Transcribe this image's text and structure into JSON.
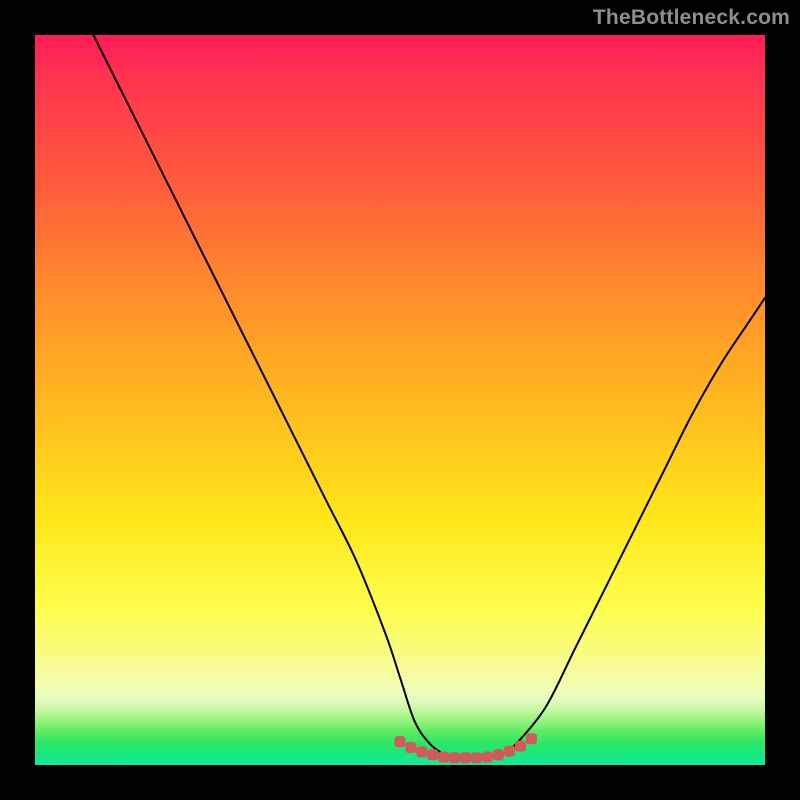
{
  "watermark": "TheBottleneck.com",
  "colors": {
    "curve": "#000000",
    "marker": "#d35a5a",
    "gradient_top": "#ff1c57",
    "gradient_mid": "#ffe61a",
    "gradient_bottom": "#11e99e",
    "frame": "#000000"
  },
  "chart_data": {
    "type": "line",
    "title": "",
    "xlabel": "",
    "ylabel": "",
    "xlim": [
      0,
      100
    ],
    "ylim": [
      0,
      100
    ],
    "series": [
      {
        "name": "bottleneck-curve",
        "x": [
          8,
          12,
          16,
          20,
          24,
          28,
          32,
          36,
          40,
          44,
          48,
          50,
          52,
          54,
          56,
          58,
          60,
          62,
          64,
          66,
          70,
          74,
          78,
          82,
          86,
          90,
          94,
          98,
          100
        ],
        "y": [
          100,
          92,
          84,
          76,
          68,
          60,
          52,
          44,
          36,
          28,
          18,
          12,
          6,
          3,
          1.5,
          1,
          1,
          1,
          1.5,
          3,
          8,
          16,
          24,
          32,
          40,
          48,
          55,
          61,
          64
        ]
      },
      {
        "name": "sweet-spot-markers",
        "x": [
          50,
          51.5,
          53,
          54.5,
          56,
          57.5,
          59,
          60.5,
          62,
          63.5,
          65,
          66.5,
          68
        ],
        "y": [
          3.2,
          2.4,
          1.8,
          1.4,
          1.1,
          1.0,
          1.0,
          1.0,
          1.1,
          1.4,
          1.9,
          2.6,
          3.6
        ]
      }
    ],
    "annotations": []
  }
}
